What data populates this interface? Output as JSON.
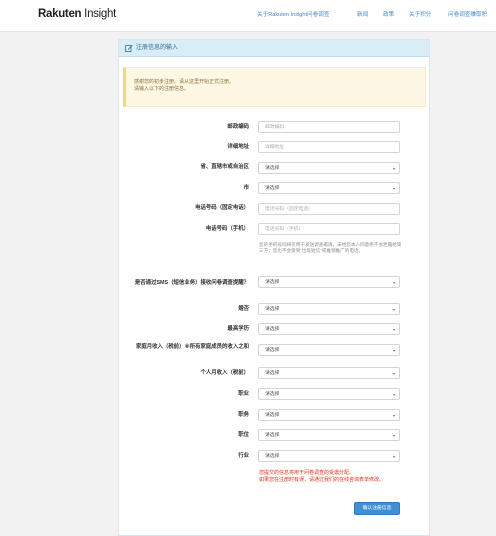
{
  "header": {
    "logo_brand": "Rakuten",
    "logo_sub": " Insight",
    "nav": [
      "关于Rakuten Insight问卷调查",
      "新闻",
      "政策",
      "关于积分",
      "问卷调查赚取积"
    ]
  },
  "panel": {
    "title": "注册信息的输入",
    "notice": [
      "感谢您的初步注册。请从这里开始正式注册。",
      "请输入以下的注册信息。"
    ]
  },
  "form": {
    "postal_label": "邮政编码",
    "postal_placeholder": "邮政编码",
    "address_label": "详细地址",
    "address_placeholder": "详细地址",
    "province_label": "省、直辖市或自治区",
    "province_value": "请选择",
    "city_label": "市",
    "city_value": "请选择",
    "phone_label": "电话号码（固定电话）",
    "phone_placeholder": "电话号码（固定电话）",
    "mobile_label": "电话号码（手机）",
    "mobile_placeholder": "电话号码（手机）",
    "mobile_help": "您的手机号码将仅用于发送调查邀请。未经您本人同意绝不会泄露给第三方；您也不会受到“垃圾短信”或推销推广的电话。",
    "sms_label": "是否通过SMS（短信业务）接收问卷调查提醒？",
    "sms_value": "请选择",
    "marriage_label": "婚否",
    "marriage_value": "请选择",
    "education_label": "最高学历",
    "education_value": "请选择",
    "household_label": "家庭月收入（税前）※所有家庭成员的收入之和",
    "household_value": "请选择",
    "personal_label": "个人月收入（税前）",
    "personal_value": "请选择",
    "job_label": "职业",
    "job_value": "请选择",
    "duty_label": "职务",
    "duty_value": "请选择",
    "position_label": "职位",
    "position_value": "请选择",
    "industry_label": "行业",
    "industry_value": "请选择"
  },
  "warning": [
    "您提交的信息将用于问卷调查的受邀分配。",
    "如果您在注册时有误，请通过我们的在线咨询表单修改。"
  ],
  "submit_label": "确认注册信息"
}
